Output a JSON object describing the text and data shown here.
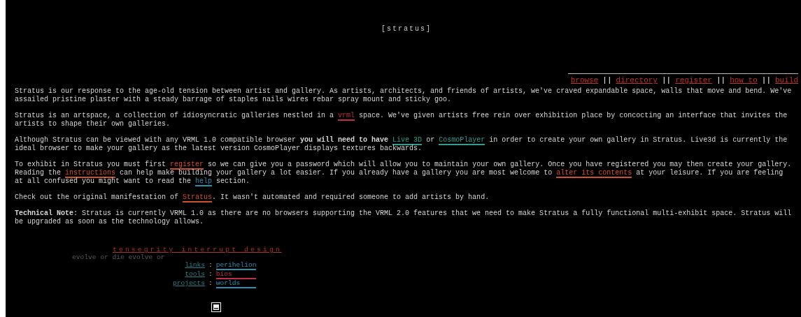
{
  "title": "[stratus]",
  "nav": [
    {
      "label": "browse"
    },
    {
      "label": "directory"
    },
    {
      "label": "register"
    },
    {
      "label": "how to"
    },
    {
      "label": "build"
    }
  ],
  "nav_separator": "||",
  "paragraphs": [
    [
      {
        "kind": "plain",
        "text": "Stratus is our response to the age-old tension between artist and gallery. As artists, architects, and friends of artists, we've craved expandable space, walls that move and bend. We've assailed pristine plaster with a steady barrage of staples nails wires rebar spray mount and sticky goo."
      }
    ],
    [
      {
        "kind": "plain",
        "text": "Stratus is an artspace, a collection of idiosyncratic galleries nestled in a "
      },
      {
        "kind": "link",
        "text": "vrml",
        "color": "#c0304a"
      },
      {
        "kind": "plain",
        "text": " space. We've given artists free rein over exhibition place by concocting an interface that invites the artists to shape their own galleries."
      }
    ],
    [
      {
        "kind": "plain",
        "text": "Although Stratus can be viewed with any VRML 1.0 compatible browser "
      },
      {
        "kind": "bold",
        "text": "you will need to have "
      },
      {
        "kind": "link",
        "text": "Live 3D",
        "color": "#2e9e8e"
      },
      {
        "kind": "plain",
        "text": " or "
      },
      {
        "kind": "link",
        "text": "CosmoPlayer",
        "color": "#2e9e8e"
      },
      {
        "kind": "plain",
        "text": " in order to create your own gallery in Stratus. Live3d is currently the ideal browser to make your gallery as the latest version CosmoPlayer displays textures backwards."
      }
    ],
    [
      {
        "kind": "plain",
        "text": "To exhibit in Stratus you must first "
      },
      {
        "kind": "link",
        "text": "register",
        "color": "#d0502c"
      },
      {
        "kind": "plain",
        "text": " so we can give you a password which will allow you to maintain your own gallery. Once you have registered you may then create your gallery. Reading the "
      },
      {
        "kind": "link",
        "text": "instructions",
        "color": "#d0502c"
      },
      {
        "kind": "plain",
        "text": " can help make building your gallery a lot easier. If you already have a gallery you are most welcome to "
      },
      {
        "kind": "link",
        "text": "alter its contents",
        "color": "#d0502c"
      },
      {
        "kind": "plain",
        "text": " at your leisure. If you are feeling at all confused you might want to read the "
      },
      {
        "kind": "link",
        "text": "help",
        "color": "#2e8eae"
      },
      {
        "kind": "plain",
        "text": " section."
      }
    ],
    [
      {
        "kind": "plain",
        "text": "Check out the original manifestation of "
      },
      {
        "kind": "link",
        "text": "Stratus",
        "color": "#d0502c"
      },
      {
        "kind": "plain",
        "text": ". It wasn't automated and required someone to add artists by hand."
      }
    ],
    [
      {
        "kind": "bold",
        "text": "Technical Note"
      },
      {
        "kind": "plain",
        "text": ": Stratus is currently VRML 1.0 as there are no browsers supporting the VRML 2.0 features that we need to make Stratus a fully functional multi-exhibit space. Stratus will be upgraded as soon as the technology allows."
      }
    ]
  ],
  "footer": {
    "heading": "tensegrity interrupt design",
    "slogan": "evolve or die evolve or",
    "links": [
      {
        "label": "links",
        "separator": ":",
        "target": "perihelion",
        "color": "#2e8eae"
      },
      {
        "label": "tools",
        "separator": ":",
        "target": "bios",
        "color": "#c0304a"
      },
      {
        "label": "projects",
        "separator": ":",
        "target": "worlds",
        "color": "#2e8eae"
      }
    ]
  }
}
